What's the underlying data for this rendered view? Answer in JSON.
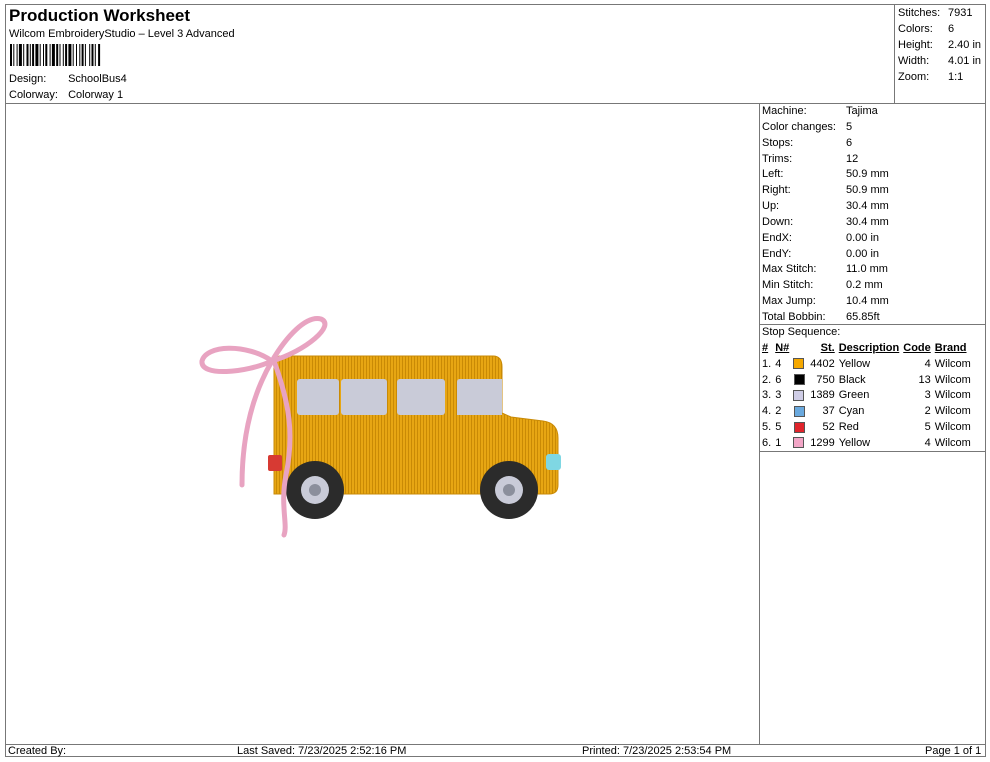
{
  "header": {
    "title": "Production Worksheet",
    "subtitle": "Wilcom EmbroideryStudio – Level 3 Advanced",
    "design_label": "Design:",
    "design_value": "SchoolBus4",
    "colorway_label": "Colorway:",
    "colorway_value": "Colorway 1"
  },
  "summary": [
    {
      "k": "Stitches:",
      "v": "7931"
    },
    {
      "k": "Colors:",
      "v": "6"
    },
    {
      "k": "Height:",
      "v": "2.40 in"
    },
    {
      "k": "Width:",
      "v": "4.01 in"
    },
    {
      "k": "Zoom:",
      "v": "1:1"
    }
  ],
  "specs": [
    {
      "k": "Machine:",
      "v": "Tajima"
    },
    {
      "k": "Color changes:",
      "v": "5"
    },
    {
      "k": "Stops:",
      "v": "6"
    },
    {
      "k": "Trims:",
      "v": "12"
    },
    {
      "k": "Left:",
      "v": "50.9 mm"
    },
    {
      "k": "Right:",
      "v": "50.9 mm"
    },
    {
      "k": "Up:",
      "v": "30.4 mm"
    },
    {
      "k": "Down:",
      "v": "30.4 mm"
    },
    {
      "k": "EndX:",
      "v": "0.00 in"
    },
    {
      "k": "EndY:",
      "v": "0.00 in"
    },
    {
      "k": "Max Stitch:",
      "v": "11.0 mm"
    },
    {
      "k": "Min Stitch:",
      "v": "0.2 mm"
    },
    {
      "k": "Max Jump:",
      "v": "10.4 mm"
    },
    {
      "k": "Total Bobbin:",
      "v": "65.85ft"
    }
  ],
  "stop_sequence": {
    "label": "Stop Sequence:",
    "columns": [
      "#",
      "N#",
      "St.",
      "Description",
      "Code",
      "Brand"
    ],
    "rows": [
      {
        "idx": "1.",
        "n": "4",
        "color": "#f5a800",
        "st": "4402",
        "desc": "Yellow",
        "code": "4",
        "brand": "Wilcom"
      },
      {
        "idx": "2.",
        "n": "6",
        "color": "#000000",
        "st": "750",
        "desc": "Black",
        "code": "13",
        "brand": "Wilcom"
      },
      {
        "idx": "3.",
        "n": "3",
        "color": "#cfcde6",
        "st": "1389",
        "desc": "Green",
        "code": "3",
        "brand": "Wilcom"
      },
      {
        "idx": "4.",
        "n": "2",
        "color": "#6aa9de",
        "st": "37",
        "desc": "Cyan",
        "code": "2",
        "brand": "Wilcom"
      },
      {
        "idx": "5.",
        "n": "5",
        "color": "#e0242b",
        "st": "52",
        "desc": "Red",
        "code": "5",
        "brand": "Wilcom"
      },
      {
        "idx": "6.",
        "n": "1",
        "color": "#f3a6c7",
        "st": "1299",
        "desc": "Yellow",
        "code": "4",
        "brand": "Wilcom"
      }
    ]
  },
  "footer": {
    "created_by": "Created By:",
    "last_saved": "Last Saved: 7/23/2025 2:52:16 PM",
    "printed": "Printed: 7/23/2025 2:53:54 PM",
    "page": "Page 1 of 1"
  }
}
